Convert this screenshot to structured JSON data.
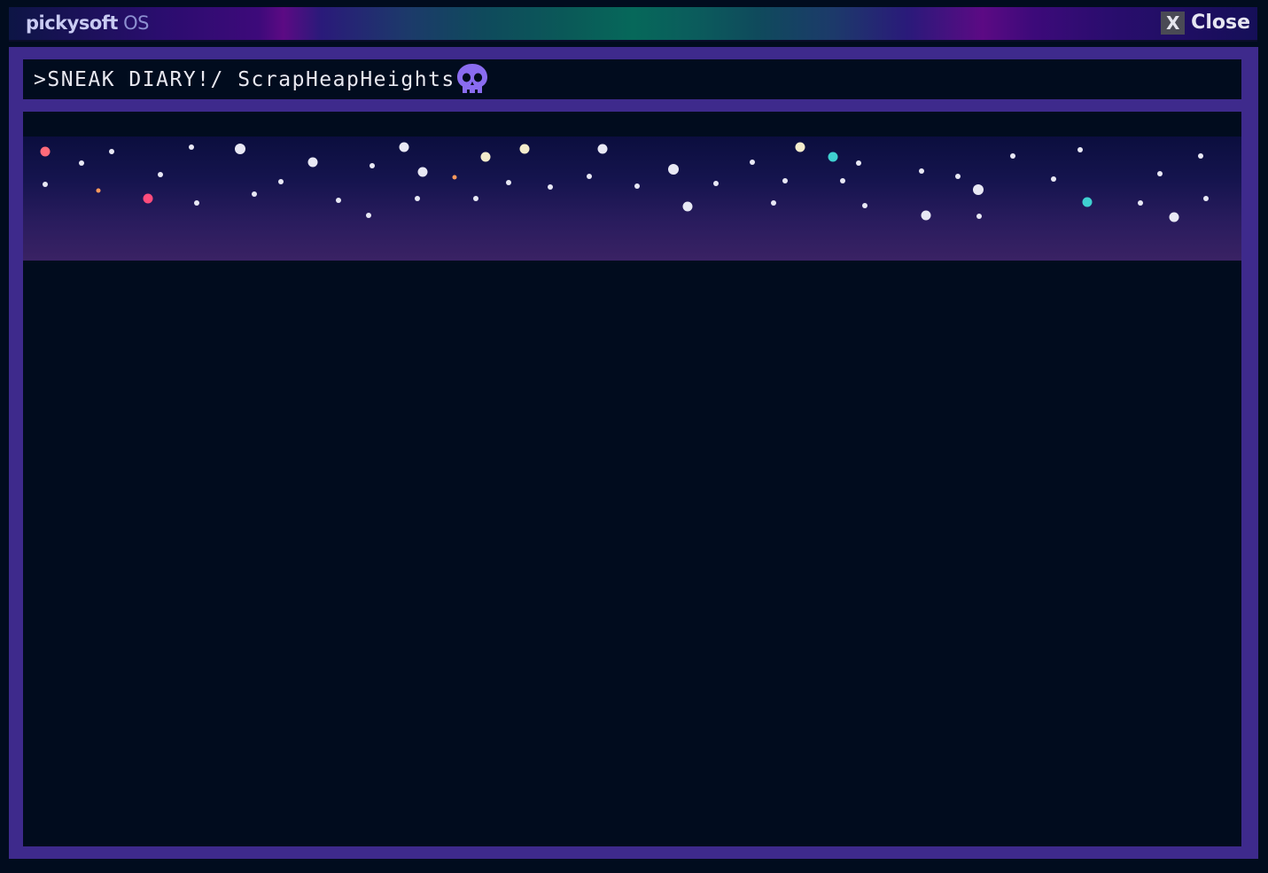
{
  "titlebar": {
    "brand_name": "pickysoft",
    "brand_os": "OS",
    "close_x": "X",
    "close_label": "Close"
  },
  "addressbar": {
    "path": ">SNEAK DIARY!/ ScrapHeapHeights",
    "icon": "skull-icon"
  },
  "colors": {
    "window_frame": "#3e2a8c",
    "background": "#010c1e",
    "skull": "#8a6cf0",
    "star_white": "#e8e8f4",
    "star_cream": "#f4eccc",
    "star_red": "#ff6a7a",
    "star_pink": "#ff4c7c",
    "star_orange": "#ff9a5c",
    "star_teal": "#3fd0d0"
  }
}
